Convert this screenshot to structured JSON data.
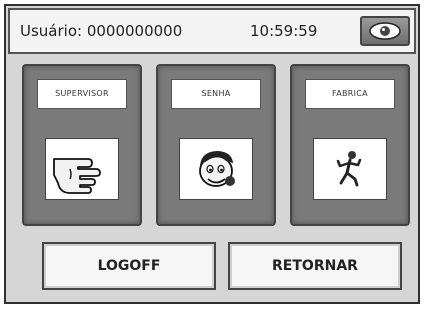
{
  "header": {
    "user": "Usuário: 0000000000",
    "time": "10:59:59",
    "eye_icon": "eye-icon"
  },
  "panels": [
    {
      "label": "SUPERVISOR",
      "icon": "pointing-hand-icon"
    },
    {
      "label": "SENHA",
      "icon": "face-icon"
    },
    {
      "label": "FABRICA",
      "icon": "running-person-icon"
    }
  ],
  "buttons": {
    "logoff": "LOGOFF",
    "retornar": "RETORNAR"
  }
}
